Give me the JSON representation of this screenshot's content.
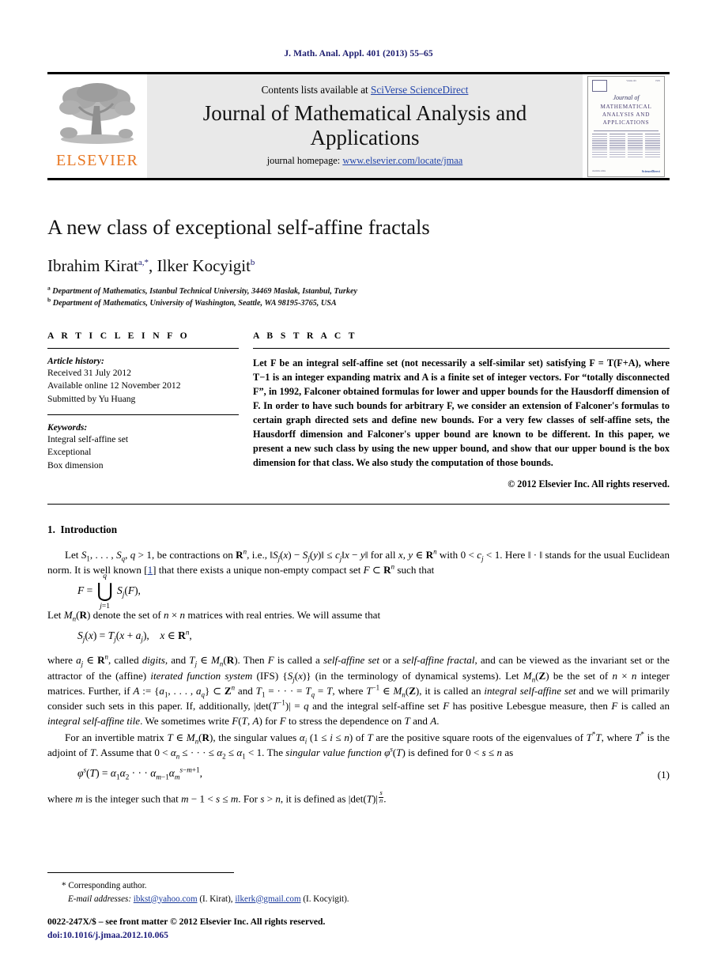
{
  "running_head": "J. Math. Anal. Appl. 401 (2013) 55–65",
  "masthead": {
    "publisher_name": "ELSEVIER",
    "contents_prefix": "Contents lists available at ",
    "contents_link": "SciVerse ScienceDirect",
    "journal_title": "Journal of Mathematical Analysis and Applications",
    "homepage_prefix": "journal homepage: ",
    "homepage_link": "www.elsevier.com/locate/jmaa",
    "cover": {
      "journal_of": "Journal of",
      "line1": "MATHEMATICAL",
      "line2": "ANALYSIS AND",
      "line3": "APPLICATIONS",
      "sciencedirect": "ScienceDirect"
    }
  },
  "article": {
    "title": "A new class of exceptional self-affine fractals",
    "authors_1": "Ibrahim Kirat",
    "authors_1_sup": "a,*",
    "authors_sep": ", ",
    "authors_2": "Ilker Kocyigit",
    "authors_2_sup": "b",
    "affiliation_a_marker": "a",
    "affiliation_a": "Department of Mathematics, Istanbul Technical University, 34469 Maslak, Istanbul, Turkey",
    "affiliation_b_marker": "b",
    "affiliation_b": "Department of Mathematics, University of Washington, Seattle, WA 98195-3765, USA"
  },
  "info": {
    "heading": "A R T I C L E   I N F O",
    "history_label": "Article history:",
    "history": [
      "Received 31 July 2012",
      "Available online 12 November 2012",
      "Submitted by Yu Huang"
    ],
    "keywords_label": "Keywords:",
    "keywords": [
      "Integral self-affine set",
      "Exceptional",
      "Box dimension"
    ]
  },
  "abstract": {
    "heading": "A B S T R A C T",
    "body": "Let F be an integral self-affine set (not necessarily a self-similar set) satisfying F = T(F+A), where T−1 is an integer expanding matrix and A is a finite set of integer vectors. For “totally disconnected F”, in 1992, Falconer obtained formulas for lower and upper bounds for the Hausdorff dimension of F. In order to have such bounds for arbitrary F, we consider an extension of Falconer's formulas to certain graph directed sets and define new bounds. For a very few classes of self-affine sets, the Hausdorff dimension and Falconer's upper bound are known to be different. In this paper, we present a new such class by using the new upper bound, and show that our upper bound is the box dimension for that class. We also study the computation of those bounds.",
    "copyright": "© 2012 Elsevier Inc. All rights reserved."
  },
  "introduction": {
    "section_number": "1.",
    "section_title": "Introduction",
    "p1": "Let S1, . . . , Sq, q > 1, be contractions on Rn, i.e., ‖Sj(x) − Sj(y)‖ ≤ cj‖x − y‖ for all x, y ∈ Rn with 0 < cj < 1. Here ‖ · ‖ stands for the usual Euclidean norm. It is well known [1] that there exists a unique non-empty compact set F ⊂ Rn such that",
    "eq_union": "F = ⋃ Sj(F),",
    "p2": "Let Mn(R) denote the set of n × n matrices with real entries. We will assume that",
    "eq_sj": "Sj(x) = Tj(x + aj),    x ∈ Rn,",
    "p3": "where aj ∈ Rn, called digits, and Tj ∈ Mn(R). Then F is called a self-affine set or a self-affine fractal, and can be viewed as the invariant set or the attractor of the (affine) iterated function system (IFS) {Sj(x)} (in the terminology of dynamical systems). Let Mn(Z) be the set of n × n integer matrices. Further, if A := {a1, . . . , aq} ⊂ Zn and T1 = · · · = Tq = T, where T−1 ∈ Mn(Z), it is called an integral self-affine set and we will primarily consider such sets in this paper. If, additionally, |det(T−1)| = q and the integral self-affine set F has positive Lebesgue measure, then F is called an integral self-affine tile. We sometimes write F(T, A) for F to stress the dependence on T and A.",
    "p4": "For an invertible matrix T ∈ Mn(R), the singular values αi (1 ≤ i ≤ n) of T are the positive square roots of the eigenvalues of T*T, where T* is the adjoint of T. Assume that 0 < αn ≤ · · · ≤ α2 ≤ α1 < 1. The singular value function φs(T) is defined for 0 < s ≤ n as",
    "eq1_number": "(1)",
    "p5": "where m is the integer such that m − 1 < s ≤ m. For s > n, it is defined as |det(T)|s/n."
  },
  "footnotes": {
    "corresponding_marker": "*",
    "corresponding_text": "Corresponding author.",
    "email_label": "E-mail addresses:",
    "email_1": "ibkst@yahoo.com",
    "email_1_owner": "(I. Kirat),",
    "email_2": "ilkerk@gmail.com",
    "email_2_owner": "(I. Kocyigit).",
    "issn_line": "0022-247X/$ – see front matter © 2012 Elsevier Inc. All rights reserved.",
    "doi_line": "doi:10.1016/j.jmaa.2012.10.065"
  }
}
